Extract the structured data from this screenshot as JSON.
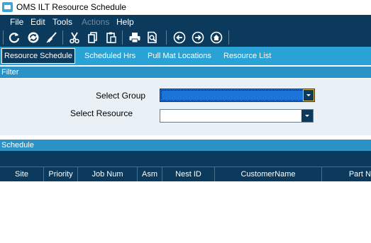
{
  "window": {
    "title": "OMS ILT Resource Schedule"
  },
  "menu": {
    "file": "File",
    "edit": "Edit",
    "tools": "Tools",
    "actions": "Actions",
    "help": "Help"
  },
  "tabs": {
    "resource_schedule": "Resource Schedule",
    "scheduled_hrs": "Scheduled Hrs",
    "pull_mat_locations": "Pull Mat Locations",
    "resource_list": "Resource List"
  },
  "filter": {
    "header": "Filter",
    "select_group_label": "Select Group",
    "select_group_value": "",
    "select_resource_label": "Select Resource",
    "select_resource_value": ""
  },
  "schedule": {
    "header": "Schedule",
    "columns": [
      "Site",
      "Priority",
      "Job Num",
      "Asm",
      "Nest ID",
      "CustomerName",
      "Part N"
    ]
  },
  "colors": {
    "accent": "#29a3d6",
    "dark": "#0b3a5c",
    "selection": "#1c74d8"
  }
}
